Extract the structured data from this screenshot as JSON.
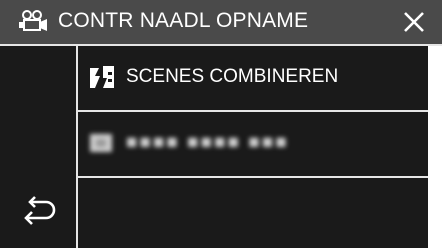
{
  "header": {
    "title": "CONTR NAADL OPNAME",
    "mode_icon": "video-camera-icon",
    "close_icon": "close-icon"
  },
  "menu": {
    "items": [
      {
        "label": "SCENES COMBINEREN",
        "icon": "combine-scenes-icon"
      },
      {
        "label": "■■■■ ■■■■ ■■■",
        "icon": "blurred-item-icon"
      }
    ]
  },
  "sidebar": {
    "back_icon": "return-arrow-icon"
  },
  "colors": {
    "background": "#1a1a1a",
    "header": "#4a4a4a",
    "divider": "#e6e6e6",
    "text": "#ffffff"
  }
}
